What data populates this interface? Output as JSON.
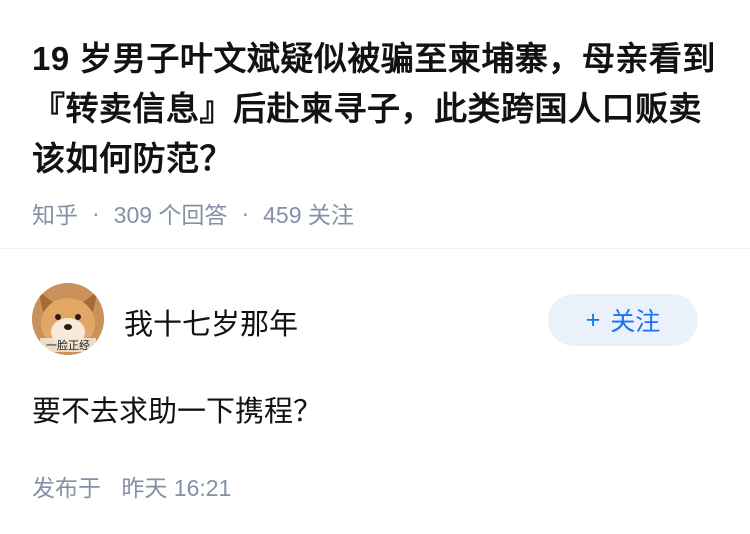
{
  "question": {
    "title": "19 岁男子叶文斌疑似被骗至柬埔寨，母亲看到『转卖信息』后赴柬寻子，此类跨国人口贩卖该如何防范？",
    "site": "知乎",
    "answer_count": "309 个回答",
    "follower_count": "459 关注",
    "separator": "·"
  },
  "answer": {
    "author": {
      "name": "我十七岁那年",
      "avatar_icon": "shiba-dog-avatar",
      "avatar_caption": "一脸正经"
    },
    "follow_button": {
      "icon": "+",
      "label": "关注"
    },
    "content": "要不去求助一下携程？",
    "published_label": "发布于",
    "published_time": "昨天 16:21"
  },
  "colors": {
    "text": "#121212",
    "meta": "#8590a6",
    "accent": "#1772f6",
    "button_bg": "#eaf1fb"
  }
}
